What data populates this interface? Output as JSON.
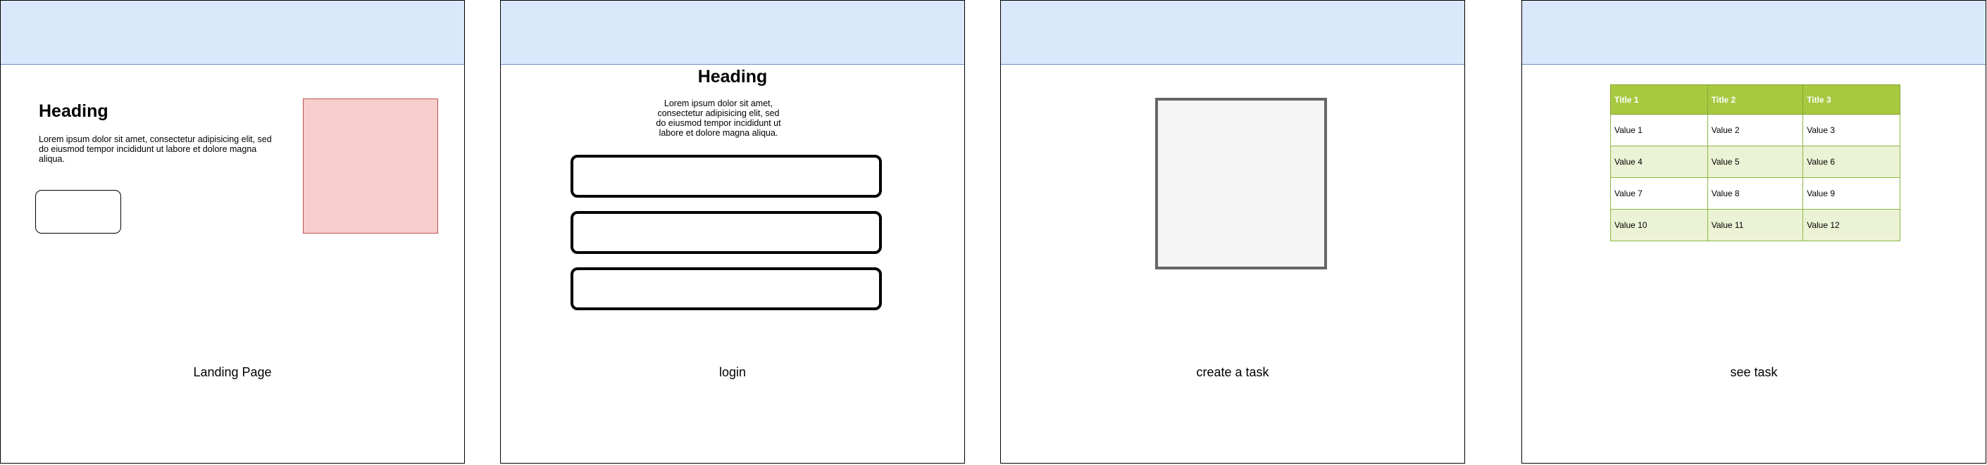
{
  "frames": {
    "landing": {
      "heading": "Heading",
      "body": "Lorem ipsum dolor sit amet, consectetur adipisicing elit, sed do eiusmod tempor incididunt ut labore et dolore magna aliqua.",
      "label": "Landing Page"
    },
    "login": {
      "heading": "Heading",
      "body": "Lorem ipsum dolor sit amet, consectetur adipisicing elit, sed do eiusmod tempor incididunt ut labore et dolore magna aliqua.",
      "label": "login"
    },
    "create": {
      "label": "create a task"
    },
    "see": {
      "label": "see task",
      "table": {
        "headers": [
          "Title 1",
          "Title 2",
          "Title 3"
        ],
        "rows": [
          [
            "Value 1",
            "Value 2",
            "Value 3"
          ],
          [
            "Value 4",
            "Value 5",
            "Value 6"
          ],
          [
            "Value 7",
            "Value 8",
            "Value 9"
          ],
          [
            "Value 10",
            "Value 11",
            "Value 12"
          ]
        ]
      }
    }
  },
  "colors": {
    "header_fill": "#dae8fc",
    "header_border": "#6c8ebf",
    "image_placeholder": "#f8cecc",
    "task_box_fill": "#f5f5f5",
    "table_header": "#a8c840",
    "table_alt_row": "#ebf2d5"
  }
}
